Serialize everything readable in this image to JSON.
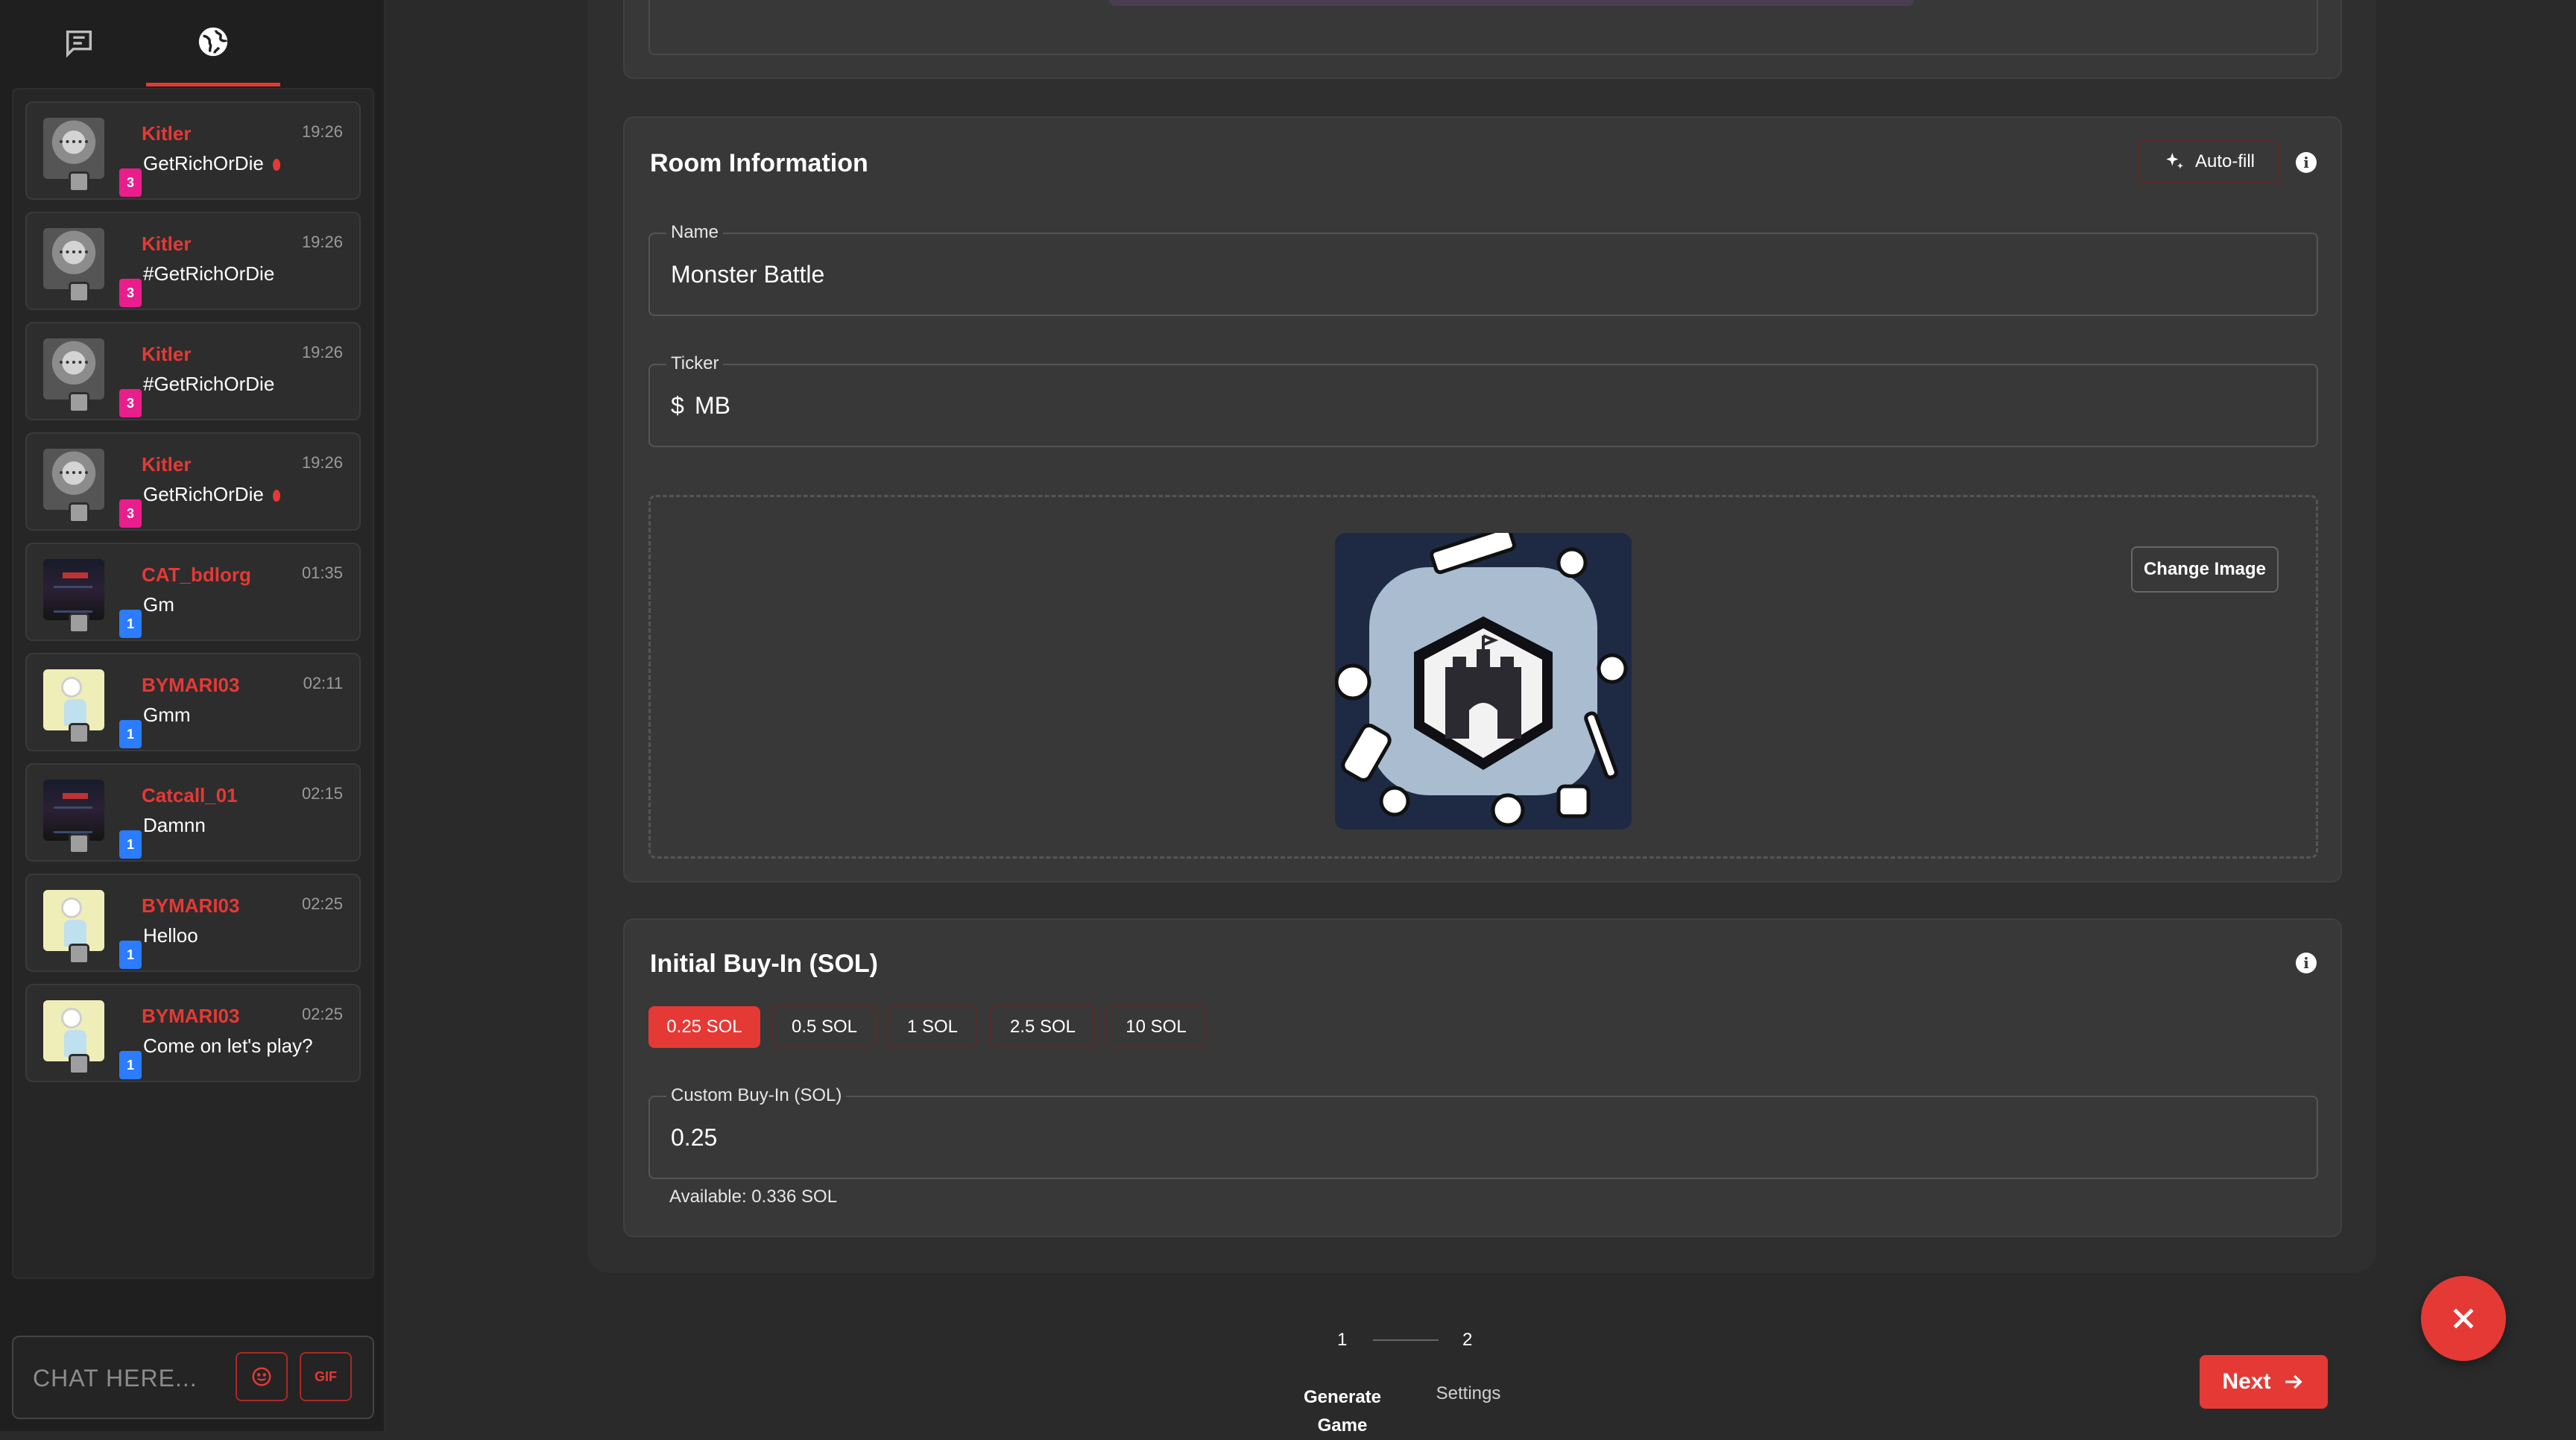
{
  "sidebar": {
    "tabs": [
      {
        "icon": "chat-icon",
        "active": false
      },
      {
        "icon": "globe-icon",
        "active": true
      }
    ],
    "messages": [
      {
        "user": "Kitler",
        "time": "19:26",
        "text": "GetRichOrDie",
        "level": "3",
        "level_color": "#e91e8c",
        "avatar": "cat-avatar",
        "flame": true
      },
      {
        "user": "Kitler",
        "time": "19:26",
        "text": "#GetRichOrDie",
        "level": "3",
        "level_color": "#e91e8c",
        "avatar": "cat-avatar",
        "flame": false
      },
      {
        "user": "Kitler",
        "time": "19:26",
        "text": "#GetRichOrDie",
        "level": "3",
        "level_color": "#e91e8c",
        "avatar": "cat-avatar",
        "flame": false
      },
      {
        "user": "Kitler",
        "time": "19:26",
        "text": "GetRichOrDie",
        "level": "3",
        "level_color": "#e91e8c",
        "avatar": "cat-avatar",
        "flame": true
      },
      {
        "user": "CAT_bdlorg",
        "time": "01:35",
        "text": "Gm",
        "level": "1",
        "level_color": "#2b7cff",
        "avatar": "screenshot-avatar",
        "flame": false
      },
      {
        "user": "BYMARI03",
        "time": "02:11",
        "text": "Gmm",
        "level": "1",
        "level_color": "#2b7cff",
        "avatar": "cartoon-avatar",
        "flame": false
      },
      {
        "user": "Catcall_01",
        "time": "02:15",
        "text": "Damnn",
        "level": "1",
        "level_color": "#2b7cff",
        "avatar": "screenshot-avatar",
        "flame": false
      },
      {
        "user": "BYMARI03",
        "time": "02:25",
        "text": "Helloo",
        "level": "1",
        "level_color": "#2b7cff",
        "avatar": "cartoon-avatar",
        "flame": false
      },
      {
        "user": "BYMARI03",
        "time": "02:25",
        "text": "Come on let's play?",
        "level": "1",
        "level_color": "#2b7cff",
        "avatar": "cartoon-avatar",
        "flame": false
      }
    ],
    "chat": {
      "placeholder": "CHAT HERE...",
      "emoji_icon": "smiley-icon",
      "gif_label": "GIF"
    }
  },
  "room_info": {
    "title": "Room Information",
    "autofill_label": "Auto-fill",
    "name_label": "Name",
    "name_value": "Monster Battle",
    "ticker_label": "Ticker",
    "ticker_prefix": "$",
    "ticker_value": "MB",
    "change_image_label": "Change Image"
  },
  "buy_in": {
    "title": "Initial Buy-In (SOL)",
    "options": [
      "0.25 SOL",
      "0.5 SOL",
      "1 SOL",
      "2.5 SOL",
      "10 SOL"
    ],
    "selected": "0.25 SOL",
    "custom_label": "Custom Buy-In (SOL)",
    "custom_value": "0.25",
    "available": "Available: 0.336 SOL"
  },
  "stepper": {
    "steps": [
      {
        "number": "1",
        "label": "Generate Game"
      },
      {
        "number": "2",
        "label": "Settings"
      }
    ]
  },
  "actions": {
    "next_label": "Next",
    "close_icon": "close-icon"
  },
  "colors": {
    "accent": "#e53935",
    "background": "#2a2a2a",
    "card": "#383838",
    "level_pink": "#e91e8c",
    "level_blue": "#2b7cff"
  }
}
